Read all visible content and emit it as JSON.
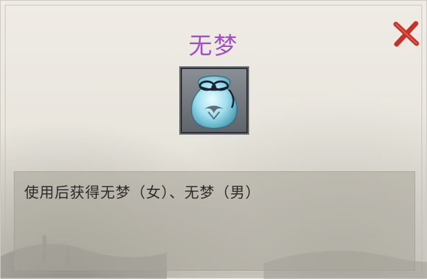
{
  "dialog": {
    "title": "无梦",
    "description": "使用后获得无梦（女）、无梦（男）"
  },
  "icons": {
    "close": "close-x-icon",
    "item": "silk-pouch-icon"
  },
  "colors": {
    "title": "#a04fc9",
    "close": "#c8302a",
    "pouch": "#8fd3e6"
  }
}
